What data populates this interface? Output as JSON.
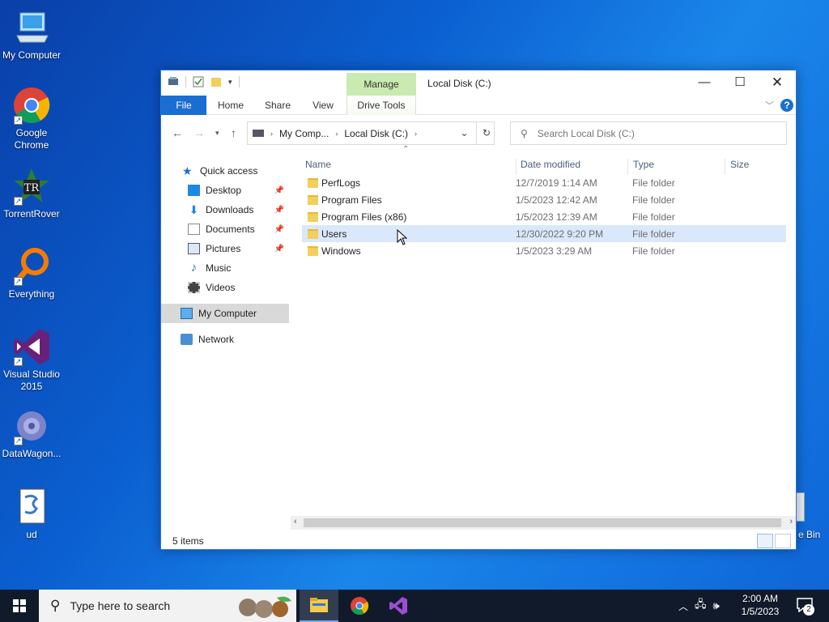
{
  "desktop": {
    "icons": [
      {
        "label": "My Computer"
      },
      {
        "label": "Google Chrome"
      },
      {
        "label": "TorrentRover"
      },
      {
        "label": "Everything"
      },
      {
        "label": "Visual Studio 2015"
      },
      {
        "label": "DataWagon..."
      },
      {
        "label": "ud"
      }
    ],
    "recycle_bin_partial": "e Bin"
  },
  "window": {
    "title": "Local Disk (C:)",
    "contextual_tab": "Manage",
    "ribbon_tabs": [
      "File",
      "Home",
      "Share",
      "View",
      "Drive Tools"
    ],
    "breadcrumb": [
      "My Comp...",
      "Local Disk (C:)"
    ],
    "search_placeholder": "Search Local Disk (C:)",
    "nav": {
      "quick_access": "Quick access",
      "items": [
        {
          "label": "Desktop",
          "icon": "desktop-icon",
          "pinned": true
        },
        {
          "label": "Downloads",
          "icon": "downloads-icon",
          "pinned": true
        },
        {
          "label": "Documents",
          "icon": "documents-icon",
          "pinned": true
        },
        {
          "label": "Pictures",
          "icon": "pictures-icon",
          "pinned": true
        },
        {
          "label": "Music",
          "icon": "music-icon",
          "pinned": false
        },
        {
          "label": "Videos",
          "icon": "videos-icon",
          "pinned": false
        }
      ],
      "my_computer": "My Computer",
      "network": "Network"
    },
    "columns": [
      "Name",
      "Date modified",
      "Type",
      "Size"
    ],
    "files": [
      {
        "name": "PerfLogs",
        "date": "12/7/2019 1:14 AM",
        "type": "File folder"
      },
      {
        "name": "Program Files",
        "date": "1/5/2023 12:42 AM",
        "type": "File folder"
      },
      {
        "name": "Program Files (x86)",
        "date": "1/5/2023 12:39 AM",
        "type": "File folder"
      },
      {
        "name": "Users",
        "date": "12/30/2022 9:20 PM",
        "type": "File folder"
      },
      {
        "name": "Windows",
        "date": "1/5/2023 3:29 AM",
        "type": "File folder"
      }
    ],
    "status": "5 items"
  },
  "taskbar": {
    "search_placeholder": "Type here to search",
    "time": "2:00 AM",
    "date": "1/5/2023",
    "notification_count": "2"
  },
  "colors": {
    "accent": "#1a6ed1",
    "manage_tab": "#c9eab0",
    "selection": "#d9e8fb"
  }
}
